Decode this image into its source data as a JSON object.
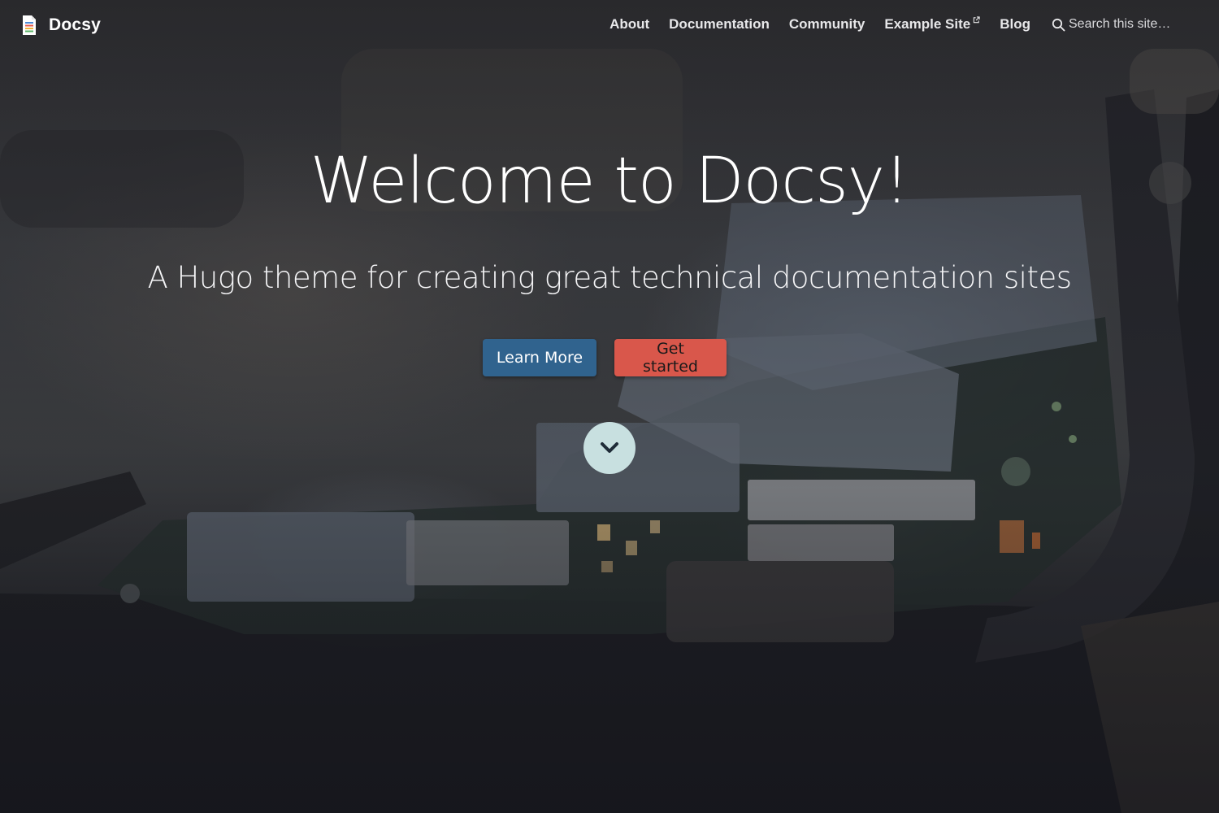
{
  "navbar": {
    "brand": "Docsy",
    "links": [
      {
        "label": "About"
      },
      {
        "label": "Documentation"
      },
      {
        "label": "Community"
      },
      {
        "label": "Example Site",
        "external": true
      },
      {
        "label": "Blog"
      }
    ],
    "search": {
      "placeholder": "Search this site…",
      "icon": "search-icon"
    }
  },
  "hero": {
    "title": "Welcome to Docsy!",
    "subtitle": "A Hugo theme for creating great technical documentation sites",
    "buttons": {
      "primary": "Learn More",
      "secondary": "Get started"
    },
    "scroll_icon": "chevron-down-icon"
  },
  "colors": {
    "primary": "#30638e",
    "secondary": "#d9574b",
    "scroll_button": "#c8e0e0"
  }
}
